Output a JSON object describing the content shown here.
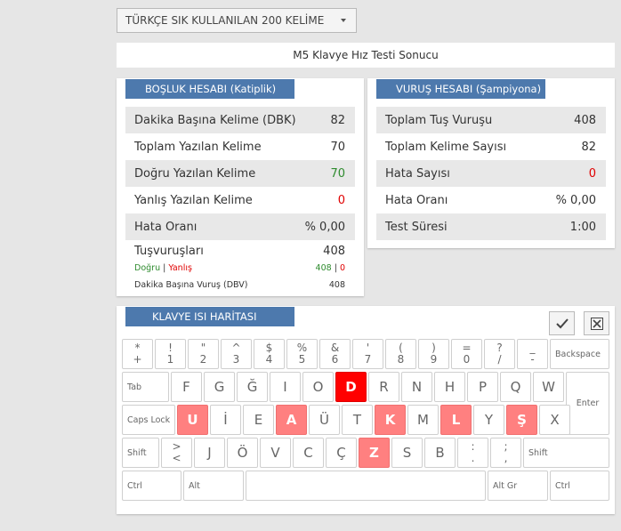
{
  "dropdown": {
    "selected": "TÜRKÇE SIK KULLANILAN 200 KELİME"
  },
  "title": "M5 Klavye Hız Testi Sonucu",
  "left_panel": {
    "header": "BOŞLUK HESABI (Katiplik)",
    "rows": [
      {
        "label": "Dakika Başına Kelime (DBK)",
        "value": "82"
      },
      {
        "label": "Toplam Yazılan Kelime",
        "value": "70"
      },
      {
        "label": "Doğru Yazılan Kelime",
        "value": "70"
      },
      {
        "label": "Yanlış Yazılan Kelime",
        "value": "0"
      },
      {
        "label": "Hata Oranı",
        "value": "% 0,00"
      }
    ],
    "keystrokes": {
      "label": "Tuşvuruşları",
      "value": "408",
      "correct_label": "Doğru",
      "wrong_label": "Yanlış",
      "separator": "|",
      "correct_value": "408",
      "wrong_value": "0",
      "dbv_label": "Dakika Başına Vuruş (DBV)",
      "dbv_value": "408"
    }
  },
  "right_panel": {
    "header": "VURUŞ HESABI (Şampiyona)",
    "rows": [
      {
        "label": "Toplam Tuş Vuruşu",
        "value": "408"
      },
      {
        "label": "Toplam Kelime Sayısı",
        "value": "82"
      },
      {
        "label": "Hata Sayısı",
        "value": "0"
      },
      {
        "label": "Hata Oranı",
        "value": "% 0,00"
      },
      {
        "label": "Test Süresi",
        "value": "1:00"
      }
    ]
  },
  "keyboard": {
    "header": "KLAVYE ISI HARİTASI",
    "colors": {
      "hot_light": "#ff8080",
      "hot_strong": "#ff0000"
    },
    "row1": [
      {
        "top": "*",
        "bottom": "+"
      },
      {
        "top": "!",
        "bottom": "1"
      },
      {
        "top": "\"",
        "bottom": "2"
      },
      {
        "top": "^",
        "bottom": "3"
      },
      {
        "top": "$",
        "bottom": "4"
      },
      {
        "top": "%",
        "bottom": "5"
      },
      {
        "top": "&",
        "bottom": "6"
      },
      {
        "top": "'",
        "bottom": "7"
      },
      {
        "top": "(",
        "bottom": "8"
      },
      {
        "top": ")",
        "bottom": "9"
      },
      {
        "top": "=",
        "bottom": "0"
      },
      {
        "top": "?",
        "bottom": "/"
      },
      {
        "top": "_",
        "bottom": "-"
      }
    ],
    "backspace": "Backspace",
    "tab": "Tab",
    "row2": [
      {
        "label": "F",
        "heat": ""
      },
      {
        "label": "G",
        "heat": ""
      },
      {
        "label": "Ğ",
        "heat": ""
      },
      {
        "label": "I",
        "heat": ""
      },
      {
        "label": "O",
        "heat": ""
      },
      {
        "label": "D",
        "heat": "strong"
      },
      {
        "label": "R",
        "heat": ""
      },
      {
        "label": "N",
        "heat": ""
      },
      {
        "label": "H",
        "heat": ""
      },
      {
        "label": "P",
        "heat": ""
      },
      {
        "label": "Q",
        "heat": ""
      },
      {
        "label": "W",
        "heat": ""
      }
    ],
    "enter": "Enter",
    "caps": "Caps Lock",
    "row3": [
      {
        "label": "U",
        "heat": "light"
      },
      {
        "label": "İ",
        "heat": ""
      },
      {
        "label": "E",
        "heat": ""
      },
      {
        "label": "A",
        "heat": "light"
      },
      {
        "label": "Ü",
        "heat": ""
      },
      {
        "label": "T",
        "heat": ""
      },
      {
        "label": "K",
        "heat": "light"
      },
      {
        "label": "M",
        "heat": ""
      },
      {
        "label": "L",
        "heat": "light"
      },
      {
        "label": "Y",
        "heat": ""
      },
      {
        "label": "Ş",
        "heat": "light"
      },
      {
        "label": "X",
        "heat": ""
      }
    ],
    "shift": "Shift",
    "row4": [
      {
        "top": ">",
        "bottom": "<",
        "heat": ""
      },
      {
        "label": "J",
        "heat": ""
      },
      {
        "label": "Ö",
        "heat": ""
      },
      {
        "label": "V",
        "heat": ""
      },
      {
        "label": "C",
        "heat": ""
      },
      {
        "label": "Ç",
        "heat": ""
      },
      {
        "label": "Z",
        "heat": "light"
      },
      {
        "label": "S",
        "heat": ""
      },
      {
        "label": "B",
        "heat": ""
      },
      {
        "top": ":",
        "bottom": ".",
        "heat": ""
      },
      {
        "top": ";",
        "bottom": ",",
        "heat": ""
      }
    ],
    "ctrl": "Ctrl",
    "alt": "Alt",
    "altgr": "Alt Gr"
  }
}
